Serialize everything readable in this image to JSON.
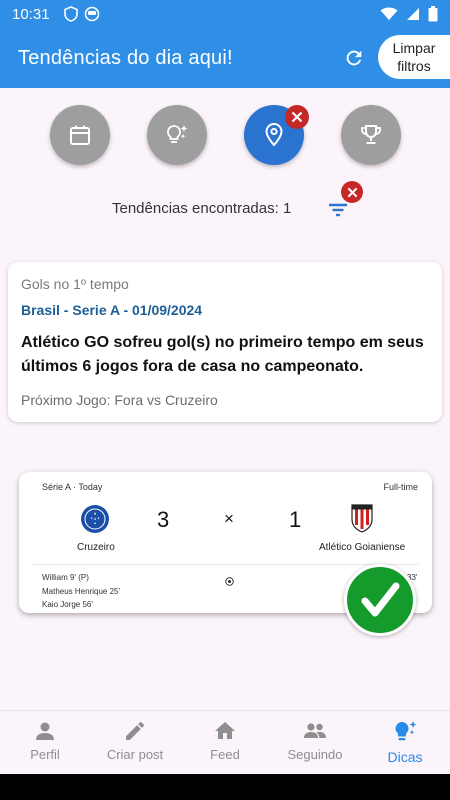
{
  "status_bar": {
    "time": "10:31"
  },
  "app_bar": {
    "title": "Tendências do dia aqui!",
    "clear_filters_label": "Limpar filtros"
  },
  "filters": [
    {
      "name": "calendar",
      "active": false
    },
    {
      "name": "lightbulb",
      "active": false
    },
    {
      "name": "location",
      "active": true
    },
    {
      "name": "trophy",
      "active": false
    }
  ],
  "results": {
    "count_text": "Tendências encontradas: 1"
  },
  "trend_card": {
    "category": "Gols no 1º tempo",
    "league_date": "Brasil - Serie A - 01/09/2024",
    "description": "Atlético GO sofreu gol(s) no primeiro tempo em seus últimos 6 jogos fora de casa no campeonato.",
    "next_game": "Próximo Jogo: Fora vs Cruzeiro"
  },
  "match_image": {
    "competition": "Série A · Today",
    "status": "Full-time",
    "home_team": "Cruzeiro",
    "away_team": "Atlético Goianiense",
    "home_score": "3",
    "away_score": "1",
    "separator": "×",
    "scorers": [
      "William 9' (P)",
      "Matheus Henrique 25'",
      "Kaio Jorge 56'"
    ],
    "away_scorer_partial": "33'"
  },
  "bottom_nav": [
    {
      "label": "Perfil",
      "icon": "person-icon"
    },
    {
      "label": "Criar post",
      "icon": "pencil-icon"
    },
    {
      "label": "Feed",
      "icon": "home-icon"
    },
    {
      "label": "Seguindo",
      "icon": "people-icon"
    },
    {
      "label": "Dicas",
      "icon": "lightbulb-icon",
      "active": true
    }
  ],
  "colors": {
    "primary": "#2f8fe6",
    "active_filter": "#2a73cf",
    "inactive_filter": "#9e9e9e",
    "badge": "#c62828",
    "success": "#159b2c"
  }
}
